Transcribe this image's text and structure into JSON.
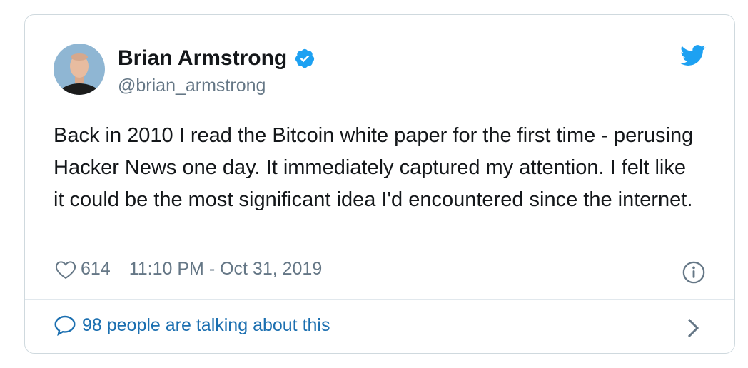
{
  "author": {
    "name": "Brian Armstrong",
    "handle": "@brian_armstrong",
    "verified": true,
    "avatar_icon": "profile-photo"
  },
  "tweet": {
    "text": "Back in 2010 I read the Bitcoin white paper for the first time - perusing Hacker News one day. It immediately captured my attention. I felt like it could be the most significant idea I'd encountered since the internet."
  },
  "meta": {
    "like_count": "614",
    "timestamp": "11:10 PM - Oct 31, 2019"
  },
  "footer": {
    "talking_label": "98 people are talking about this"
  },
  "colors": {
    "brand": "#1da1f2",
    "text": "#14171a",
    "muted": "#657786",
    "link": "#1b6fb0",
    "border": "#cfd9de"
  },
  "icons": {
    "verified": "verified-badge-icon",
    "logo": "twitter-bird-icon",
    "like": "heart-icon",
    "info": "info-icon",
    "reply": "speech-bubble-icon",
    "more": "chevron-right-icon"
  }
}
